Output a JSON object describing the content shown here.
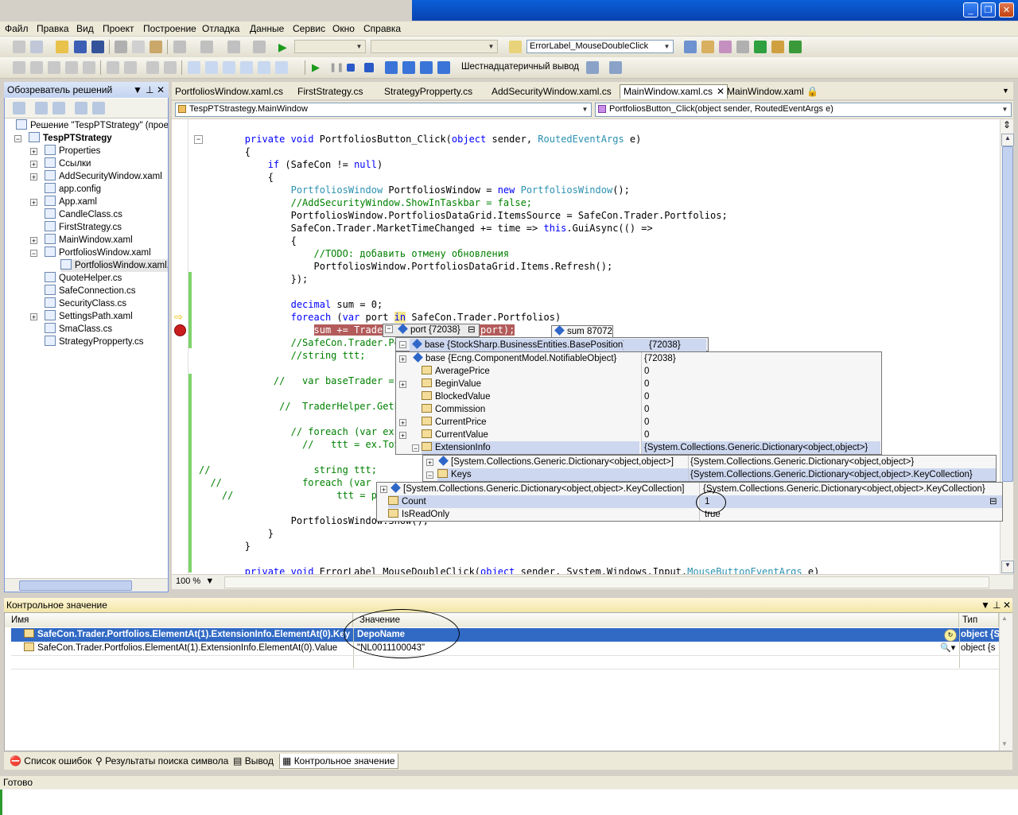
{
  "menu": [
    "Файл",
    "Правка",
    "Вид",
    "Проект",
    "Построение",
    "Отладка",
    "Данные",
    "Сервис",
    "Окно",
    "Справка"
  ],
  "toolbar": {
    "find_combo": "ErrorLabel_MouseDoubleClick",
    "hex_label": "Шестнадцатеричный вывод"
  },
  "solution_explorer": {
    "title": "Обозреватель решений",
    "items": [
      {
        "label": "Решение \"TespPTStrategy\" (проект",
        "indent": 0,
        "exp": ""
      },
      {
        "label": "TespPTStrategy",
        "indent": 1,
        "exp": "-",
        "bold": true
      },
      {
        "label": "Properties",
        "indent": 2,
        "exp": "+"
      },
      {
        "label": "Ссылки",
        "indent": 2,
        "exp": "+"
      },
      {
        "label": "AddSecurityWindow.xaml",
        "indent": 2,
        "exp": "+"
      },
      {
        "label": "app.config",
        "indent": 2,
        "exp": ""
      },
      {
        "label": "App.xaml",
        "indent": 2,
        "exp": "+"
      },
      {
        "label": "CandleClass.cs",
        "indent": 2,
        "exp": ""
      },
      {
        "label": "FirstStrategy.cs",
        "indent": 2,
        "exp": ""
      },
      {
        "label": "MainWindow.xaml",
        "indent": 2,
        "exp": "+"
      },
      {
        "label": "PortfoliosWindow.xaml",
        "indent": 2,
        "exp": "-"
      },
      {
        "label": "PortfoliosWindow.xaml.cs",
        "indent": 3,
        "exp": ""
      },
      {
        "label": "QuoteHelper.cs",
        "indent": 2,
        "exp": ""
      },
      {
        "label": "SafeConnection.cs",
        "indent": 2,
        "exp": ""
      },
      {
        "label": "SecurityClass.cs",
        "indent": 2,
        "exp": ""
      },
      {
        "label": "SettingsPath.xaml",
        "indent": 2,
        "exp": "+"
      },
      {
        "label": "SmaClass.cs",
        "indent": 2,
        "exp": ""
      },
      {
        "label": "StrategyPropperty.cs",
        "indent": 2,
        "exp": ""
      }
    ]
  },
  "tabs": [
    "PortfoliosWindow.xaml.cs",
    "FirstStrategy.cs",
    "StrategyPropperty.cs",
    "AddSecurityWindow.xaml.cs",
    "MainWindow.xaml.cs",
    "MainWindow.xaml"
  ],
  "nav": {
    "type": "TespPTStrastegy.MainWindow",
    "member": "PortfoliosButton_Click(object sender, RoutedEventArgs e)"
  },
  "zoom": "100 %",
  "datatip": {
    "port_label": "port",
    "port_value": "{72038}",
    "sum_label": "sum",
    "sum_value": "87072",
    "base_name": "base {StockSharp.BusinessEntities.BasePosition}",
    "base_value": "{72038}",
    "rows": [
      {
        "name": "base {Ecng.ComponentModel.NotifiableObject}",
        "value": "{72038}"
      },
      {
        "name": "AveragePrice",
        "value": "0"
      },
      {
        "name": "BeginValue",
        "value": "0"
      },
      {
        "name": "BlockedValue",
        "value": "0"
      },
      {
        "name": "Commission",
        "value": "0"
      },
      {
        "name": "CurrentPrice",
        "value": "0"
      },
      {
        "name": "CurrentValue",
        "value": "0"
      },
      {
        "name": "ExtensionInfo",
        "value": "{System.Collections.Generic.Dictionary<object,object>}"
      }
    ],
    "dict_name": "[System.Collections.Generic.Dictionary<object,object>]",
    "dict_value": "{System.Collections.Generic.Dictionary<object,object>}",
    "keys_name": "Keys",
    "keys_value": "{System.Collections.Generic.Dictionary<object,object>.KeyCollection}",
    "kc_name": "[System.Collections.Generic.Dictionary<object,object>.KeyCollection]",
    "kc_value": "{System.Collections.Generic.Dictionary<object,object>.KeyCollection}",
    "count_name": "Count",
    "count_value": "1",
    "ro_name": "IsReadOnly",
    "ro_value": "true"
  },
  "watch": {
    "title": "Контрольное значение",
    "col_name": "Имя",
    "col_value": "Значение",
    "col_type": "Тип",
    "rows": [
      {
        "name": "SafeCon.Trader.Portfolios.ElementAt(1).ExtensionInfo.ElementAt(0).Key",
        "value": "DepoName",
        "type": "object {S"
      },
      {
        "name": "SafeCon.Trader.Portfolios.ElementAt(1).ExtensionInfo.ElementAt(0).Value",
        "value": "\"NL0011100043\"",
        "type": "object {s"
      }
    ]
  },
  "bottom_tabs": [
    "Список ошибок",
    "Результаты поиска символа",
    "Вывод",
    "Контрольное значение"
  ],
  "status": "Готово"
}
